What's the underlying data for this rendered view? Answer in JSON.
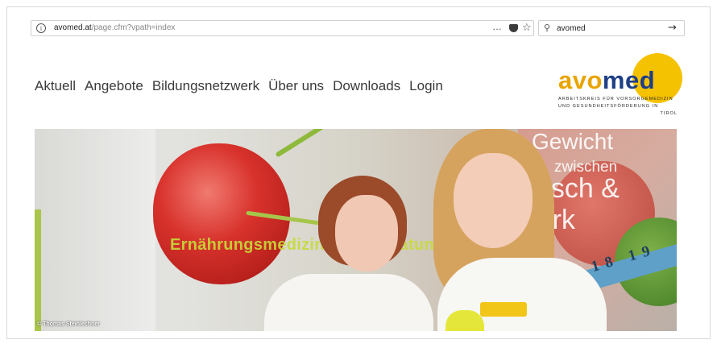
{
  "browser": {
    "url_host": "avomed.at",
    "url_path": "/page.cfm?vpath=index",
    "page_actions": "…",
    "search_query": "avomed"
  },
  "nav": {
    "items": [
      "Aktuell",
      "Angebote",
      "Bildungsnetzwerk",
      "Über uns",
      "Downloads",
      "Login"
    ]
  },
  "logo": {
    "word_part1": "avo",
    "word_part2": "med",
    "tagline_line1": "ARBEITSKREIS FÜR VORSORGEMEDIZIN",
    "tagline_line2": "UND GESUNDHEITSFÖRDERUNG IN",
    "tagline_line3": "TIROL"
  },
  "hero": {
    "poster_title": "Gewicht",
    "poster_mid": "zwischen",
    "poster_bottom": "unsch & Wirk",
    "poster_banner": "Ernährungsmedizinische Beratun",
    "tape_numbers": "18 19",
    "photo_credit": "© Thomas Steinlechner"
  },
  "colors": {
    "logo_orange": "#e9a400",
    "logo_blue": "#1f3f86",
    "logo_sun": "#f5c200",
    "nav_text": "#3a3a3a"
  },
  "icons": {
    "info": "info-icon",
    "pocket": "pocket-icon",
    "bookmark": "star-icon",
    "search": "search-icon",
    "go": "arrow-right-icon"
  }
}
